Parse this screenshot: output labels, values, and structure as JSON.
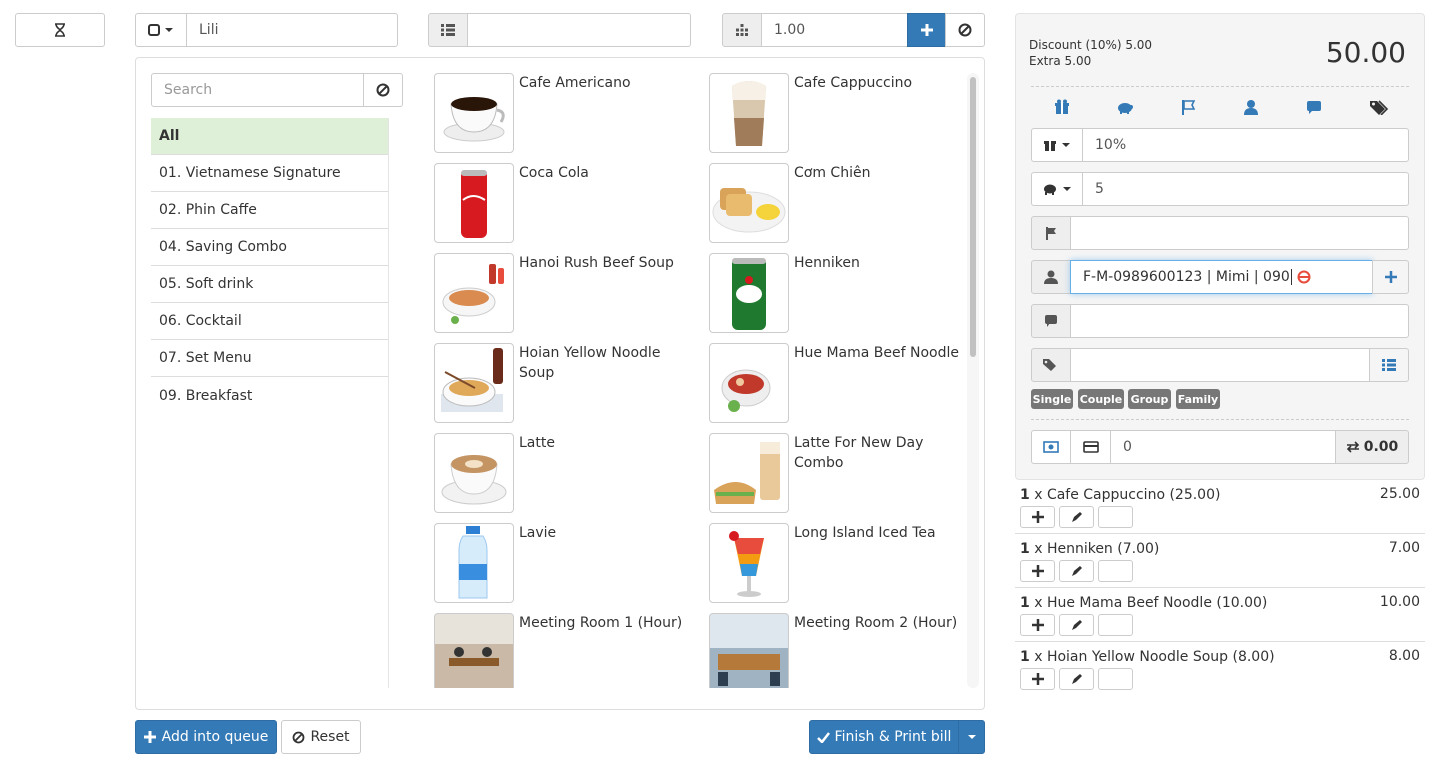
{
  "toolbar": {
    "timer_icon": "hourglass-icon",
    "customer_type_icon": "square-icon",
    "customer_name": "Lili",
    "list_icon": "list-icon",
    "table_value": "",
    "qty_icon": "grid-icon",
    "quantity": "1.00"
  },
  "search": {
    "placeholder": "Search",
    "value": ""
  },
  "categories": [
    "All",
    "01. Vietnamese Signature",
    "02. Phin Caffe",
    "04. Saving Combo",
    "05. Soft drink",
    "06. Cocktail",
    "07. Set Menu",
    "09. Breakfast"
  ],
  "products": [
    "Cafe Americano",
    "Cafe Cappuccino",
    "Coca Cola",
    "Cơm Chiên",
    "Hanoi Rush Beef Soup",
    "Henniken",
    "Hoian Yellow Noodle Soup",
    "Hue Mama Beef Noodle",
    "Latte",
    "Latte For New Day Combo",
    "Lavie",
    "Long Island Iced Tea",
    "Meeting Room 1 (Hour)",
    "Meeting Room 2 (Hour)"
  ],
  "summary": {
    "discount": "Discount (10%) 5.00",
    "extra": "Extra 5.00",
    "total": "50.00"
  },
  "tabs": [
    "gift-icon",
    "piggy-bank-icon",
    "flag-icon",
    "user-icon",
    "comment-icon",
    "tags-icon"
  ],
  "fields": {
    "discount": "10%",
    "extra": "5",
    "flag": "",
    "customer": "F-M-0989600123 | Mimi | 090",
    "note": "",
    "tags": ""
  },
  "tags": [
    "Single",
    "Couple",
    "Group",
    "Family"
  ],
  "payment": {
    "amount": "0",
    "change": "0.00"
  },
  "order_lines": [
    {
      "qty": "1",
      "name": "x Cafe Cappuccino (25.00)",
      "total": "25.00"
    },
    {
      "qty": "1",
      "name": "x Henniken (7.00)",
      "total": "7.00"
    },
    {
      "qty": "1",
      "name": "x Hue Mama Beef Noodle (10.00)",
      "total": "10.00"
    },
    {
      "qty": "1",
      "name": "x Hoian Yellow Noodle Soup (8.00)",
      "total": "8.00"
    }
  ],
  "actions": {
    "queue": "Add into queue",
    "reset": "Reset",
    "finish": "Finish & Print bill"
  },
  "colors": {
    "primary": "#337ab7",
    "danger": "#d9534f",
    "active_category": "#dff0d8",
    "tag": "#777777",
    "input_error_icon": "#e74c3c"
  }
}
